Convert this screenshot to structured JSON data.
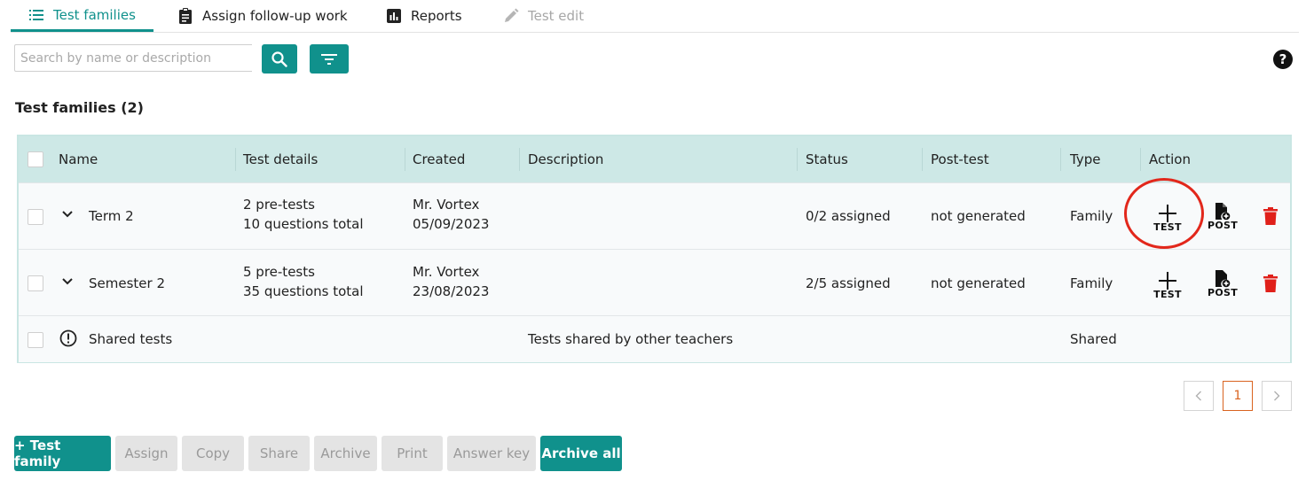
{
  "tabs": [
    {
      "label": "Test families",
      "icon": "list-icon",
      "state": "active"
    },
    {
      "label": "Assign follow-up work",
      "icon": "clipboard-icon",
      "state": "normal"
    },
    {
      "label": "Reports",
      "icon": "bar-chart-icon",
      "state": "normal"
    },
    {
      "label": "Test edit",
      "icon": "pencil-icon",
      "state": "disabled"
    }
  ],
  "search": {
    "placeholder": "Search by name or description",
    "value": ""
  },
  "section_title": "Test families (2)",
  "table": {
    "headers": [
      "Name",
      "Test details",
      "Created",
      "Description",
      "Status",
      "Post-test",
      "Type",
      "Action"
    ],
    "rows": [
      {
        "name": "Term 2",
        "details_line1": "2 pre-tests",
        "details_line2": "10 questions total",
        "created_by": "Mr. Vortex",
        "created_date": "05/09/2023",
        "description": "",
        "status": "0/2 assigned",
        "post_test": "not generated",
        "type": "Family"
      },
      {
        "name": "Semester 2",
        "details_line1": "5 pre-tests",
        "details_line2": "35 questions total",
        "created_by": "Mr. Vortex",
        "created_date": "23/08/2023",
        "description": "",
        "status": "2/5 assigned",
        "post_test": "not generated",
        "type": "Family"
      },
      {
        "name": "Shared tests",
        "description": "Tests shared by other teachers",
        "type": "Shared"
      }
    ],
    "action_labels": {
      "test": "TEST",
      "post": "POST"
    }
  },
  "pagination": {
    "current": "1"
  },
  "buttons": {
    "add_family": "+ Test family",
    "assign": "Assign",
    "copy": "Copy",
    "share": "Share",
    "archive": "Archive",
    "print": "Print",
    "answer_key": "Answer key",
    "archive_all": "Archive all"
  },
  "colors": {
    "accent": "#10918c",
    "header_bg": "#cde8e6",
    "delete": "#e0201a",
    "highlight": "#e2271b"
  }
}
